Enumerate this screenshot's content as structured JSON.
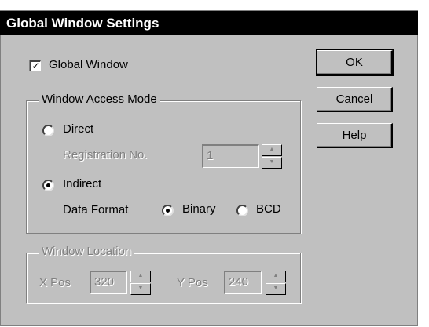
{
  "dialog": {
    "title": "Global Window Settings"
  },
  "global_window": {
    "label": "Global Window",
    "checked": true,
    "mark": "✓"
  },
  "buttons": {
    "ok": "OK",
    "cancel": "Cancel",
    "help_mnemonic": "H",
    "help_rest": "elp"
  },
  "access_mode": {
    "group_label": "Window Access Mode",
    "direct_label": "Direct",
    "registration_label": "Registration No.",
    "registration_value": "1",
    "indirect_label": "Indirect",
    "selected": "Indirect",
    "data_format_label": "Data Format",
    "binary_label": "Binary",
    "bcd_label": "BCD",
    "data_format_selected": "Binary"
  },
  "location": {
    "group_label": "Window Location",
    "x_label": "X Pos",
    "x_value": "320",
    "y_label": "Y Pos",
    "y_value": "240"
  },
  "icons": {
    "spin_up": "▲",
    "spin_down": "▼"
  }
}
